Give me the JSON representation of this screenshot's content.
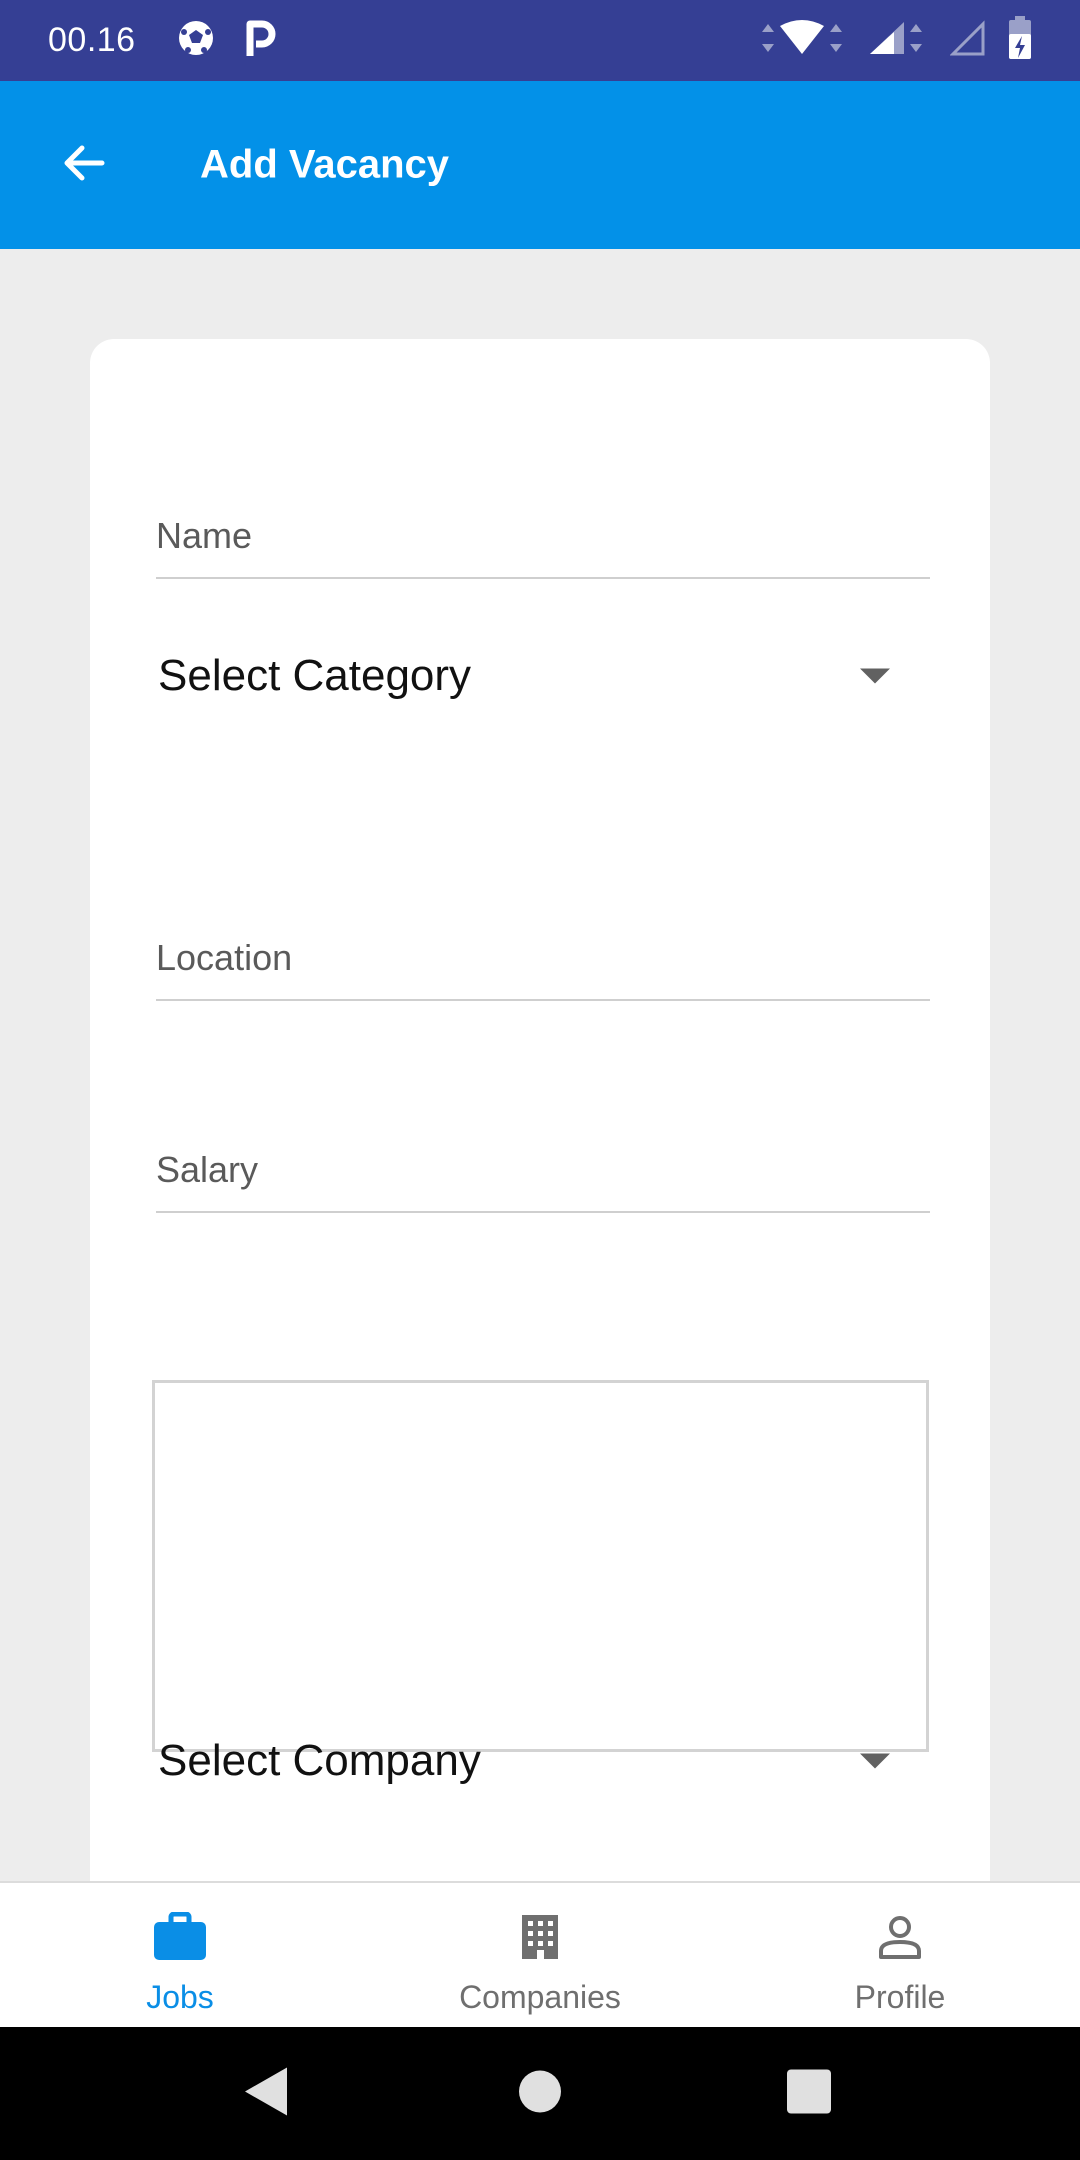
{
  "status_bar": {
    "time": "00.16",
    "icons": [
      "soccer-ball-icon",
      "p-app-icon",
      "wifi-icon",
      "signal-icon",
      "signal-empty-icon",
      "battery-charging-icon"
    ]
  },
  "app_bar": {
    "title": "Add Vacancy",
    "back_icon": "arrow-back-icon"
  },
  "form": {
    "name_placeholder": "Name",
    "category_label": "Select Category",
    "location_placeholder": "Location",
    "salary_placeholder": "Salary",
    "description_value": "",
    "company_label": "Select Company"
  },
  "bottom_nav": {
    "items": [
      {
        "label": "Jobs",
        "icon": "briefcase-icon",
        "active": true
      },
      {
        "label": "Companies",
        "icon": "building-icon",
        "active": false
      },
      {
        "label": "Profile",
        "icon": "person-icon",
        "active": false
      }
    ]
  },
  "colors": {
    "status_bar": "#353f94",
    "app_bar": "#0391e8",
    "accent": "#0a8ee6",
    "background": "#ededed"
  }
}
